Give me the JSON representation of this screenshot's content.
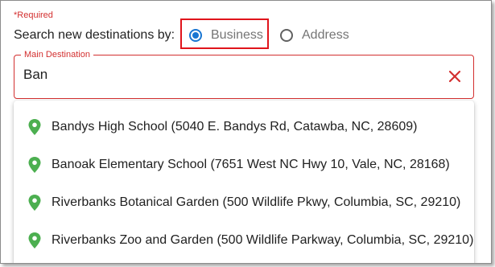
{
  "form": {
    "required_label": "*Required",
    "search_by_label": "Search new destinations by:",
    "options": [
      {
        "label": "Business",
        "selected": true
      },
      {
        "label": "Address",
        "selected": false
      }
    ],
    "main_destination": {
      "label": "Main Destination",
      "value": "Ban"
    }
  },
  "suggestions": [
    {
      "text": "Bandys High School (5040 E. Bandys Rd, Catawba, NC, 28609)",
      "icon": "map-pin-icon"
    },
    {
      "text": "Banoak Elementary School (7651 West NC Hwy 10, Vale, NC, 28168)",
      "icon": "map-pin-icon"
    },
    {
      "text": "Riverbanks Botanical Garden (500 Wildlife Pkwy, Columbia, SC, 29210)",
      "icon": "map-pin-icon"
    },
    {
      "text": "Riverbanks Zoo and Garden (500 Wildlife Parkway, Columbia, SC, 29210)",
      "icon": "map-pin-icon"
    }
  ],
  "colors": {
    "error_red": "#d32f2f",
    "highlight_red": "#e0141b",
    "radio_blue": "#1976d2",
    "pin_green": "#4caf50"
  }
}
